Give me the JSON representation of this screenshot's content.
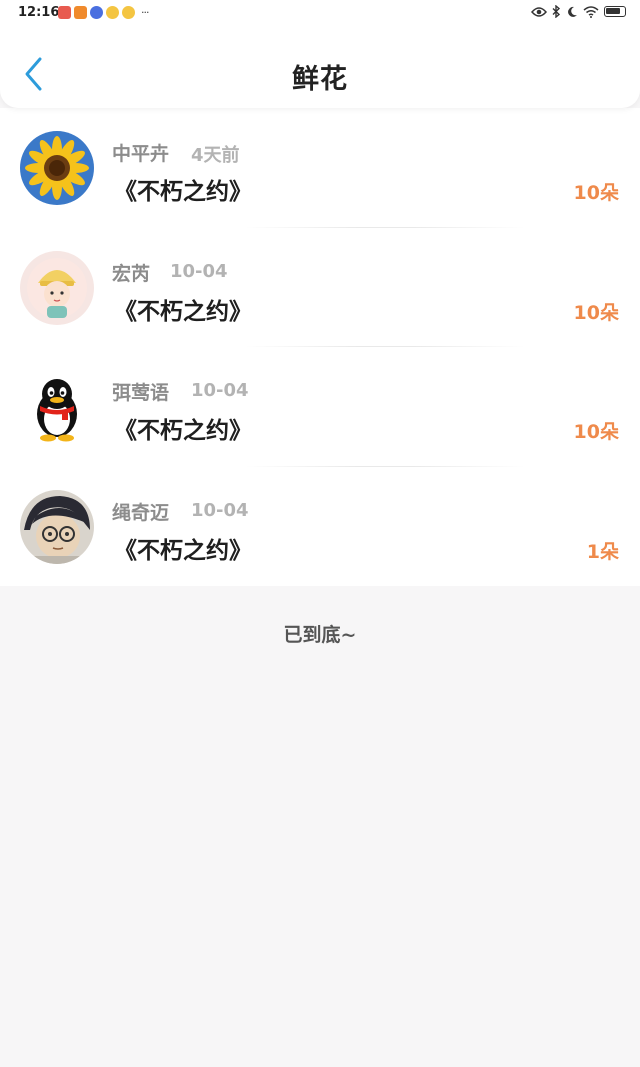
{
  "status_bar": {
    "time": "12:16",
    "more": "···"
  },
  "header": {
    "title": "鲜花"
  },
  "flowers": [
    {
      "name": "中平卉",
      "date": "4天前",
      "gift": "《不朽之约》",
      "count": "10朵"
    },
    {
      "name": "宏芮",
      "date": "10-04",
      "gift": "《不朽之约》",
      "count": "10朵"
    },
    {
      "name": "弭莺语",
      "date": "10-04",
      "gift": "《不朽之约》",
      "count": "10朵"
    },
    {
      "name": "绳奇迈",
      "date": "10-04",
      "gift": "《不朽之约》",
      "count": "1朵"
    }
  ],
  "footer": {
    "end_text": "已到底~"
  },
  "colors": {
    "accent_blue": "#2d9cdb",
    "count_orange": "#ef8a4b"
  }
}
